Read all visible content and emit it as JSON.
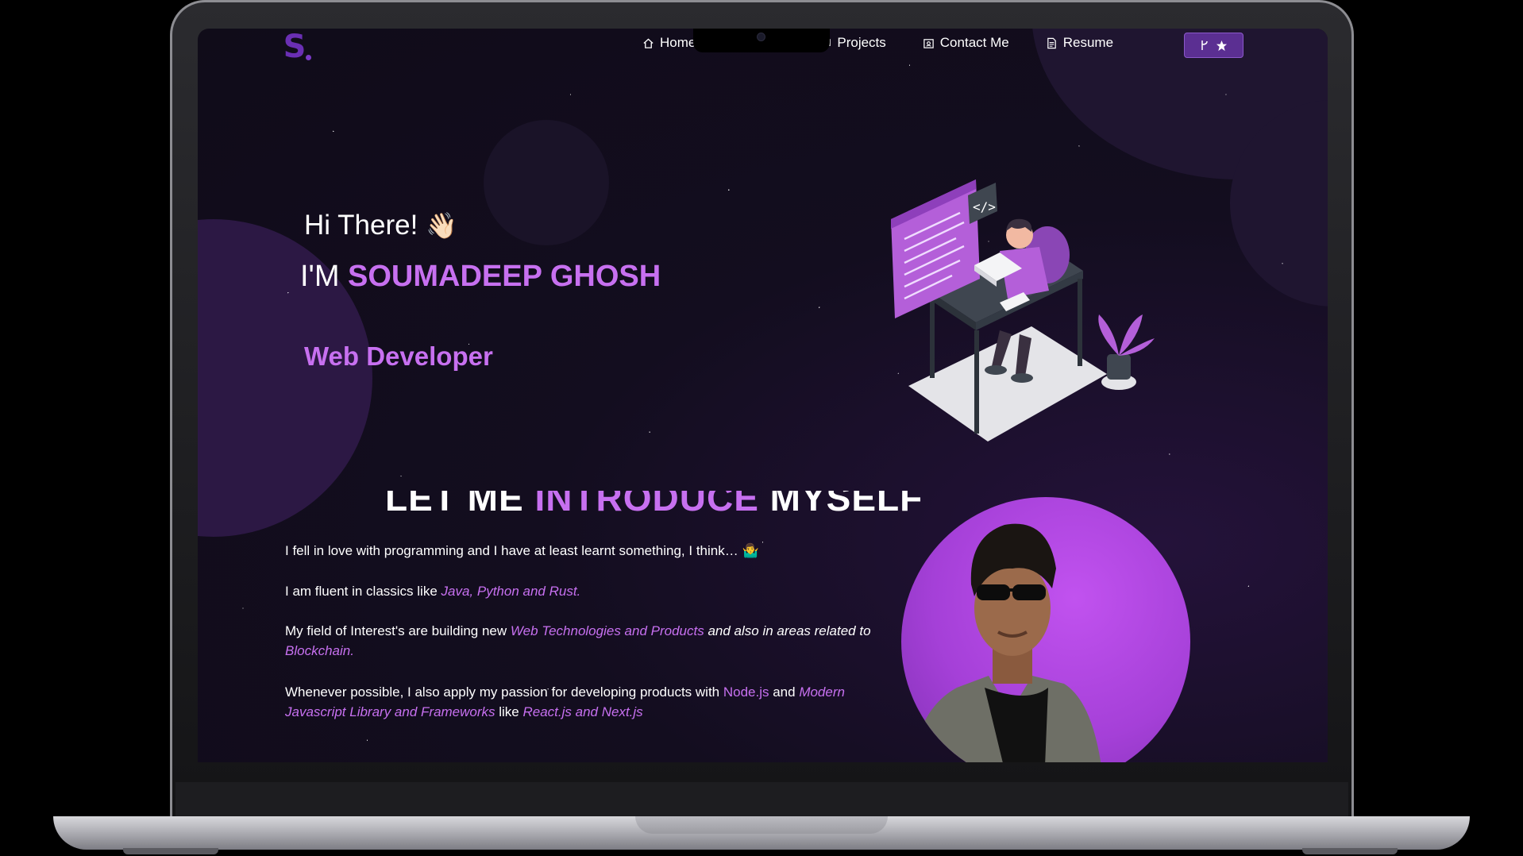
{
  "nav": {
    "logo": "S",
    "home": "Home",
    "projects": "Projects",
    "contact": "Contact Me",
    "resume": "Resume",
    "fork_icon": "git-fork-icon",
    "star_icon": "star-icon"
  },
  "hero": {
    "greeting": "Hi There!",
    "wave": "👋🏻",
    "im": "I'M",
    "name": "SOUMADEEP GHOSH",
    "role": "Web Developer"
  },
  "intro": {
    "title_a": "LET ME ",
    "title_b": "INTRODUCE",
    "title_c": " MYSELF",
    "p1": "I fell in love with programming and I have at least learnt something, I think… ",
    "p1_emoji": "🤷‍♂️",
    "p2_a": "I am fluent in classics like ",
    "p2_b": "Java, Python and Rust.",
    "p3_a": "My field of Interest's are building new  ",
    "p3_b": "Web Technologies and Products",
    "p3_c": " and also in areas related to ",
    "p3_d": "Blockchain.",
    "p4_a": "Whenever possible, I also apply my passion for developing products with ",
    "p4_b": "Node.js",
    "p4_c": " and ",
    "p4_d": "Modern Javascript Library and Frameworks",
    "p4_e": "  like ",
    "p4_f": "React.js and Next.js"
  },
  "colors": {
    "accent": "#c770f0",
    "background": "#130d1f",
    "button": "#5b2f92"
  }
}
